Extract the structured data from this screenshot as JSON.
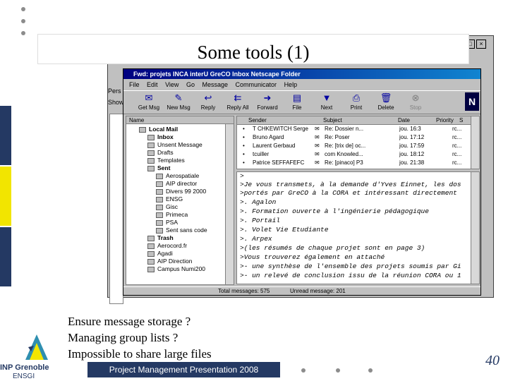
{
  "slide": {
    "title": "Some tools (1)",
    "bullets": [
      "Ensure message storage ?",
      "Managing group lists ?",
      "Impossible to share large files"
    ],
    "footer": "Project Management  Presentation 2008",
    "page_number": "40",
    "logo_main": "INP Grenoble",
    "logo_sub": "ENSGI",
    "colors": {
      "navy": "#243963",
      "teal": "#2f8fb0",
      "yellow": "#f2e500"
    }
  },
  "back_window": {
    "side_labels": [
      "Pers",
      "Show"
    ]
  },
  "window": {
    "title": "Fwd: projets INCA interU GreCO   Inbox   Netscape Folder",
    "menu": [
      "File",
      "Edit",
      "View",
      "Go",
      "Message",
      "Communicator",
      "Help"
    ],
    "toolbar": [
      {
        "label": "Get Msg",
        "icon": "get-msg-icon"
      },
      {
        "label": "New Msg",
        "icon": "new-msg-icon"
      },
      {
        "label": "Reply",
        "icon": "reply-icon"
      },
      {
        "label": "Reply All",
        "icon": "reply-all-icon"
      },
      {
        "label": "Forward",
        "icon": "forward-icon"
      },
      {
        "label": "File",
        "icon": "file-icon"
      },
      {
        "label": "Next",
        "icon": "next-icon"
      },
      {
        "label": "Print",
        "icon": "print-icon"
      },
      {
        "label": "Delete",
        "icon": "delete-icon"
      },
      {
        "label": "Stop",
        "icon": "stop-icon"
      }
    ],
    "folder_header": "Name",
    "folders": [
      {
        "label": "Local Mail",
        "bold": true
      },
      {
        "label": "Inbox",
        "bold": true
      },
      {
        "label": "Unsent Message",
        "bold": false
      },
      {
        "label": "Drafts",
        "bold": false
      },
      {
        "label": "Templates",
        "bold": false
      },
      {
        "label": "Sent",
        "bold": true
      },
      {
        "label": "Aerospatiale",
        "bold": false
      },
      {
        "label": "AIP director",
        "bold": false
      },
      {
        "label": "Divers 99 2000",
        "bold": false
      },
      {
        "label": "ENSG",
        "bold": false
      },
      {
        "label": "Gisc",
        "bold": false
      },
      {
        "label": "Primeca",
        "bold": false
      },
      {
        "label": "PSA",
        "bold": false
      },
      {
        "label": "Sent sans code",
        "bold": false
      },
      {
        "label": "Trash",
        "bold": true
      },
      {
        "label": "Aerocord.fr",
        "bold": false
      },
      {
        "label": "Agadi",
        "bold": false
      },
      {
        "label": "AIP Direction",
        "bold": false
      },
      {
        "label": "Campus Numi200",
        "bold": false
      }
    ],
    "message_columns": [
      "Sender",
      "Subject",
      "Date",
      "Priority",
      "S"
    ],
    "messages": [
      {
        "sender": "T CHKEWITCH Serge",
        "subject": "Re: Dossier n...",
        "date": "jou. 16:3",
        "priority": "",
        "status": "rc..."
      },
      {
        "sender": "Bruno Agard",
        "subject": "Re: Poser",
        "date": "jou. 17:12",
        "priority": "",
        "status": "rc..."
      },
      {
        "sender": "Laurent Gerbaud",
        "subject": "Re: [trix de] oc...",
        "date": "jou. 17:59",
        "priority": "",
        "status": "rc..."
      },
      {
        "sender": "tcuiller",
        "subject": "com Knowled...",
        "date": "jou. 18:12",
        "priority": "",
        "status": "rc..."
      },
      {
        "sender": "Patrice SEFFAFEFC",
        "subject": "Re: [pinaco] P3",
        "date": "jou. 21:38",
        "priority": "",
        "status": "rc..."
      }
    ],
    "body_lines": [
      ">",
      ">Je vous transmets, à la demande d'Yves Einnet, les dos",
      ">portés par GreCO à la CORA et intéressant directement",
      ">. Agalon",
      ">. Formation ouverte à l'ingénierie pédagogique",
      ">. Portail",
      ">. Volet Vie Etudiante",
      ">. Arpex",
      ">(les résumés de chaque projet sont en page 3)",
      ">Vous trouverez également en attaché",
      ">- une synthèse de l'ensemble des projets soumis par Gi",
      ">- un relevé de conclusion issu de la réunion CORA ou 1"
    ],
    "status_total": "Total messages: 575",
    "status_unread": "Unread message: 201"
  }
}
